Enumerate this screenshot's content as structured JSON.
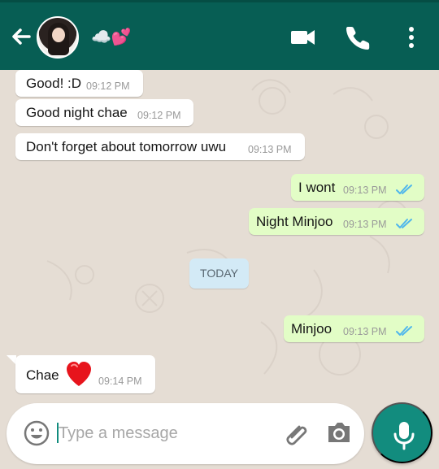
{
  "header": {
    "contact_name": "☁️💕",
    "icons": [
      "back-arrow-icon",
      "profile-avatar",
      "video-call-icon",
      "voice-call-icon",
      "more-options-icon"
    ]
  },
  "messages": [
    {
      "direction": "incoming",
      "text": "Good! :D",
      "time": "09:12 PM"
    },
    {
      "direction": "incoming",
      "text": "Good night chae",
      "time": "09:12 PM"
    },
    {
      "direction": "incoming",
      "text": "Don't forget about tomorrow uwu",
      "time": "09:13 PM"
    },
    {
      "direction": "outgoing",
      "text": "I wont",
      "time": "09:13 PM",
      "status": "read"
    },
    {
      "direction": "outgoing",
      "text": "Night Minjoo",
      "time": "09:13 PM",
      "status": "read"
    },
    {
      "direction": "date_separator",
      "text": "TODAY"
    },
    {
      "direction": "outgoing",
      "text": "Minjoo",
      "time": "09:13 PM",
      "status": "read"
    },
    {
      "direction": "incoming",
      "text": "Chae",
      "emoji": "red-heart-icon",
      "time": "09:14 PM"
    }
  ],
  "composer": {
    "placeholder": "Type a message",
    "icons": [
      "emoji-icon",
      "attachment-icon",
      "camera-icon",
      "microphone-icon"
    ]
  },
  "colors": {
    "header": "#075e54",
    "chat_background": "#e5ddd4",
    "incoming_bubble": "#ffffff",
    "outgoing_bubble": "#e2fdc6",
    "read_ticks": "#4fb6ec",
    "mic_button": "#128c7e"
  }
}
